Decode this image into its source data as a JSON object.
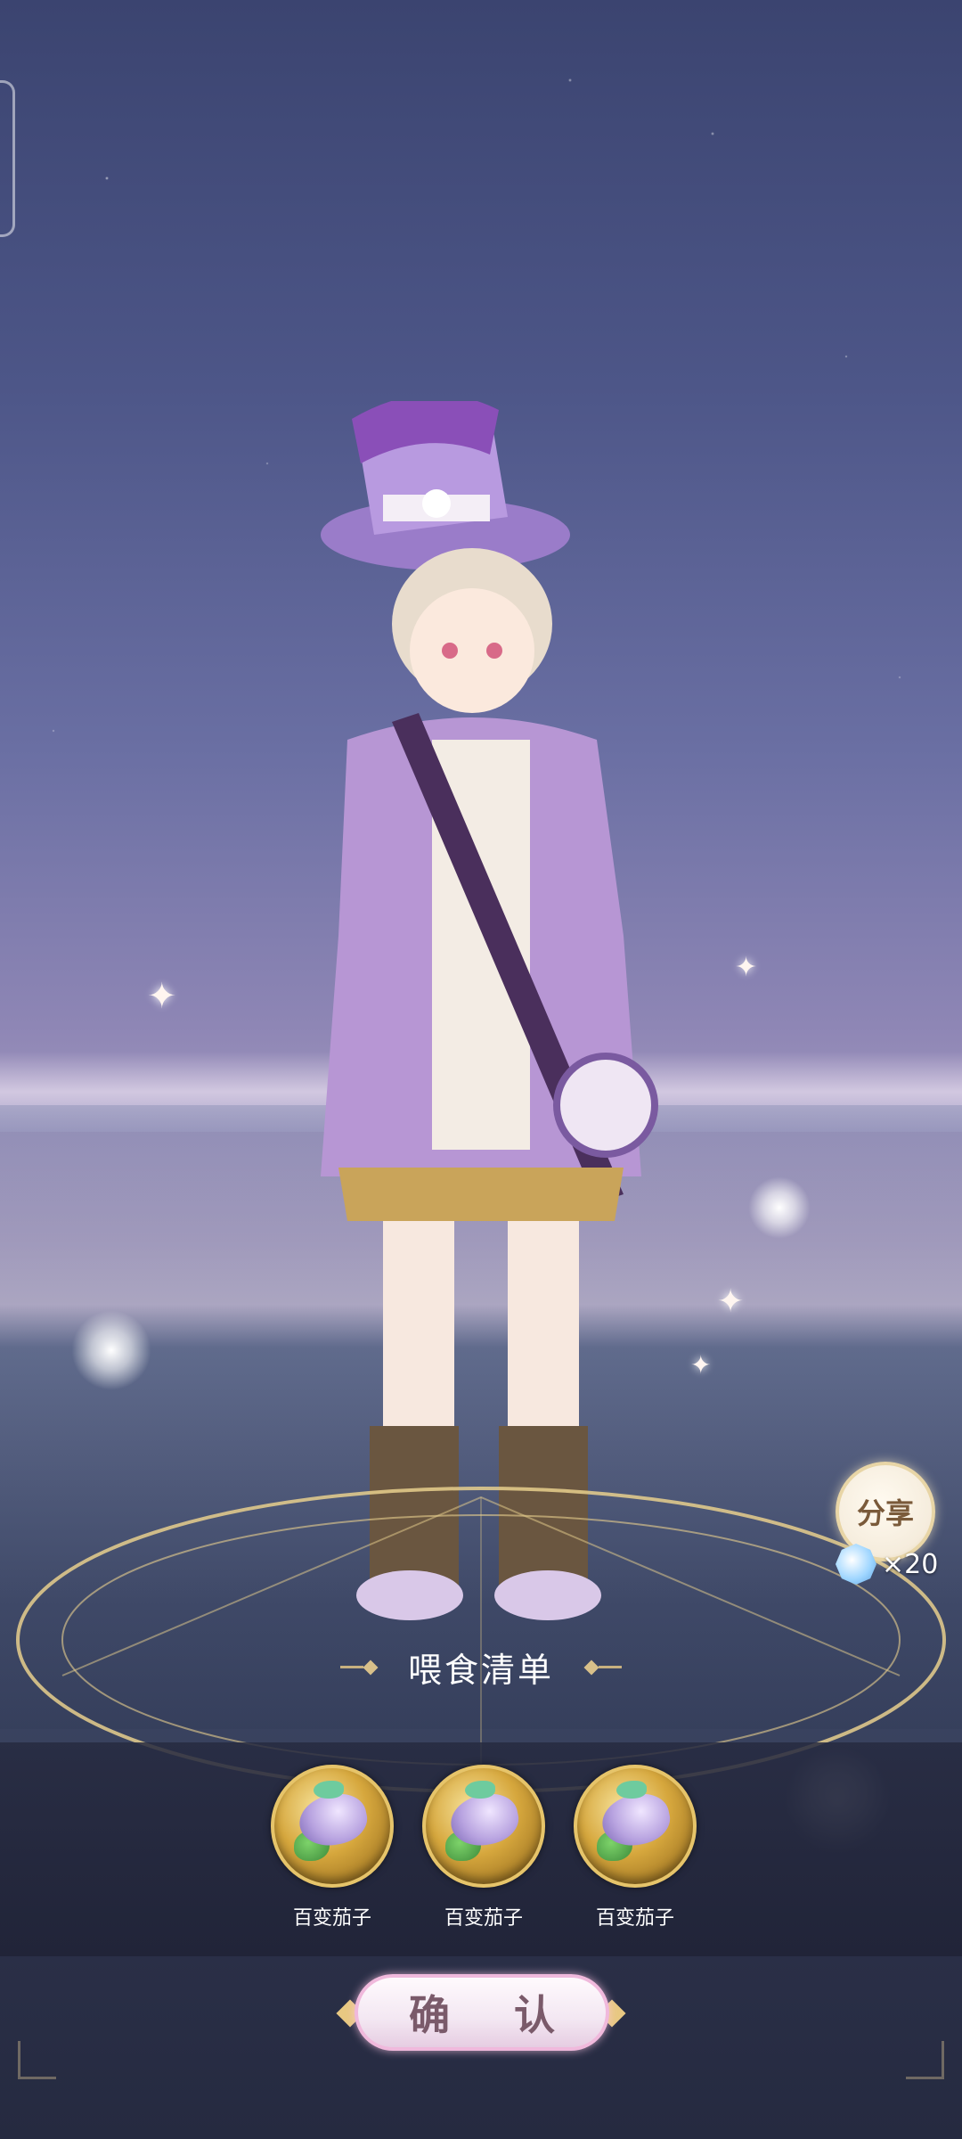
{
  "share": {
    "label": "分享"
  },
  "reward": {
    "text": "×20"
  },
  "feed_list": {
    "title": "喂食清单",
    "items": [
      {
        "name": "百变茄子"
      },
      {
        "name": "百变茄子"
      },
      {
        "name": "百变茄子"
      }
    ]
  },
  "confirm": {
    "label": "确 认"
  },
  "colors": {
    "accent_gold": "#d8c08a",
    "confirm_border": "#f0b9dc",
    "panel_bg": "#262a40"
  }
}
